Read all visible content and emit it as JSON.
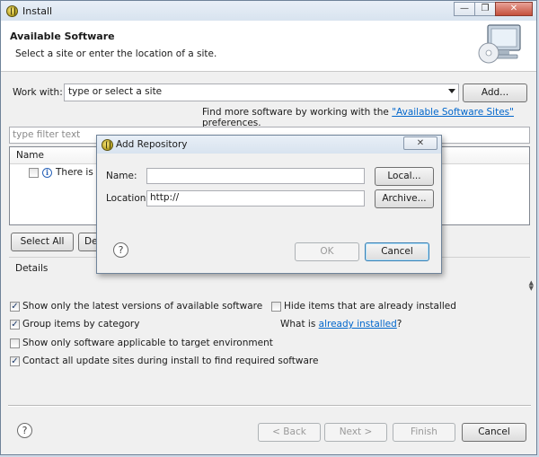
{
  "window": {
    "title": "Install",
    "minimize_glyph": "—",
    "restore_glyph": "❐",
    "close_glyph": "✕"
  },
  "header": {
    "title": "Available Software",
    "subtitle": "Select a site or enter the location of a site.",
    "icon": "monitor-cd-icon"
  },
  "work_with": {
    "label": "Work with:",
    "combo_value": "type or select a site",
    "add_button": "Add..."
  },
  "find_more": {
    "prefix": "Find more software by working with the ",
    "link": "\"Available Software Sites\"",
    "suffix": " preferences."
  },
  "filter": {
    "placeholder": "type filter text"
  },
  "tree": {
    "column_header": "Name",
    "row_text": "There is n"
  },
  "tree_buttons": {
    "select_all": "Select All",
    "deselect_all": "De"
  },
  "details": {
    "label": "Details"
  },
  "options": {
    "latest_versions": {
      "label": "Show only the latest versions of available software",
      "checked": true
    },
    "group_by_category": {
      "label": "Group items by category",
      "checked": true
    },
    "target_env": {
      "label": "Show only software applicable to target environment",
      "checked": false
    },
    "contact_sites": {
      "label": "Contact all update sites during install to find required software",
      "checked": true
    },
    "hide_installed": {
      "label": "Hide items that are already installed",
      "checked": false
    },
    "what_is": {
      "prefix": "What is ",
      "link": "already installed",
      "suffix": "?"
    }
  },
  "footer": {
    "back": "< Back",
    "next": "Next >",
    "finish": "Finish",
    "cancel": "Cancel",
    "help_glyph": "?"
  },
  "dialog": {
    "title": "Add Repository",
    "close_glyph": "✕",
    "name_label": "Name:",
    "name_value": "",
    "local_button": "Local...",
    "location_label": "Location:",
    "location_value": "http://",
    "archive_button": "Archive...",
    "ok_button": "OK",
    "cancel_button": "Cancel",
    "help_glyph": "?"
  }
}
